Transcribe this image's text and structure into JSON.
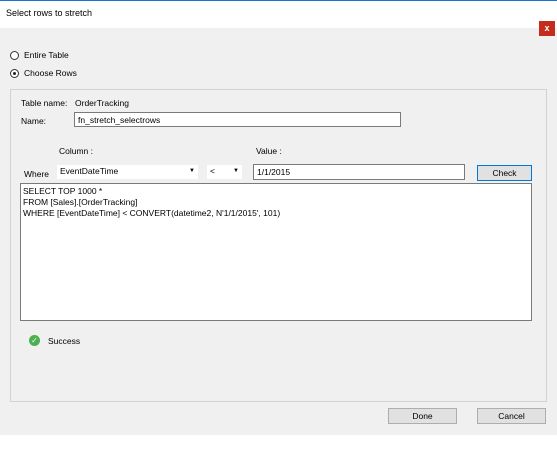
{
  "window": {
    "title": "Select rows to stretch",
    "close_label": "x"
  },
  "options": {
    "entire_table_label": "Entire Table",
    "choose_rows_label": "Choose Rows",
    "selected": "choose_rows"
  },
  "form": {
    "table_name_label": "Table name:",
    "table_name_value": "OrderTracking",
    "name_label": "Name:",
    "name_value": "fn_stretch_selectrows",
    "column_header": "Column :",
    "value_header": "Value :",
    "where_label": "Where",
    "column_value": "EventDateTime",
    "operator_value": "<",
    "value_input": "1/1/2015",
    "check_button": "Check"
  },
  "query": {
    "lines": [
      "SELECT TOP 1000 *",
      "FROM [Sales].[OrderTracking]",
      "WHERE [EventDateTime] < CONVERT(datetime2, N'1/1/2015', 101)"
    ]
  },
  "status": {
    "text": "Success",
    "icon": "check-circle-icon"
  },
  "footer": {
    "done_button": "Done",
    "cancel_button": "Cancel"
  }
}
